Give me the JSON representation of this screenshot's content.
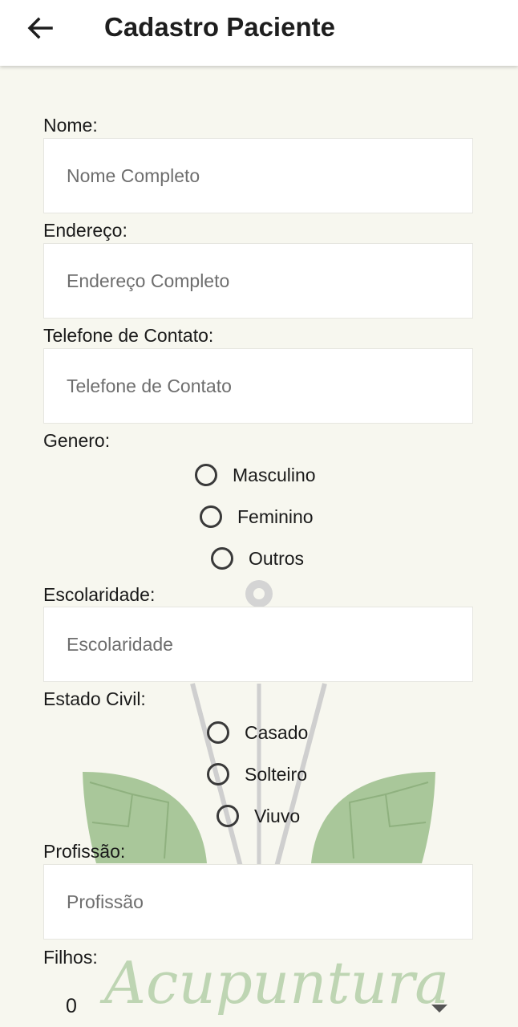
{
  "header": {
    "title": "Cadastro Paciente",
    "back_icon": "arrow-left-icon"
  },
  "form": {
    "nome": {
      "label": "Nome:",
      "placeholder": "Nome Completo"
    },
    "endereco": {
      "label": "Endereço:",
      "placeholder": "Endereço Completo"
    },
    "telefone": {
      "label": "Telefone de Contato:",
      "placeholder": "Telefone de Contato"
    },
    "genero": {
      "label": "Genero:",
      "options": [
        "Masculino",
        "Feminino",
        "Outros"
      ]
    },
    "escolaridade": {
      "label": "Escolaridade:",
      "placeholder": "Escolaridade"
    },
    "estado_civil": {
      "label": "Estado Civil:",
      "options": [
        "Casado",
        "Solteiro",
        "Viuvo"
      ]
    },
    "profissao": {
      "label": "Profissão:",
      "placeholder": "Profissão"
    },
    "filhos": {
      "label": "Filhos:",
      "selected": "0"
    }
  },
  "watermark": {
    "text": "Acupuntura",
    "leaf_color": "#a9c79a",
    "needle_color": "#c8c8c8"
  },
  "colors": {
    "background": "#f7f7ef",
    "toolbar": "#ffffff",
    "field": "#ffffff"
  }
}
